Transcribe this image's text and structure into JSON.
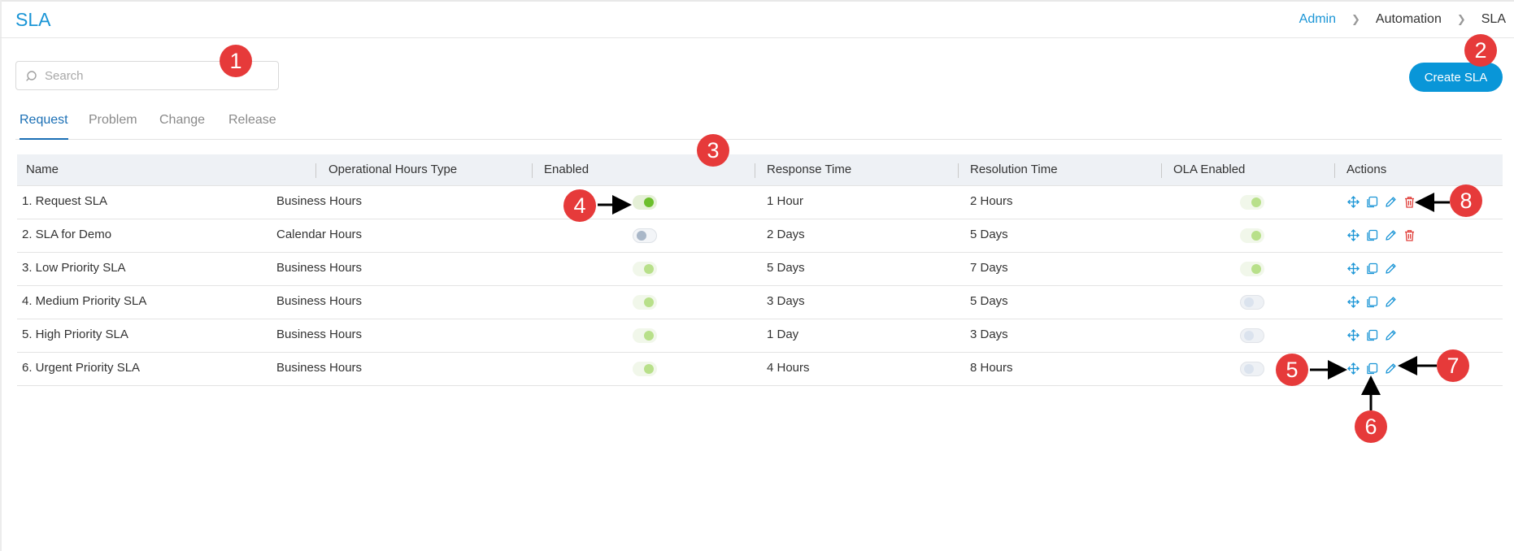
{
  "header": {
    "title": "SLA",
    "breadcrumb": [
      "Admin",
      "Automation",
      "SLA"
    ]
  },
  "search": {
    "placeholder": "Search",
    "value": ""
  },
  "create_button": {
    "label": "Create SLA"
  },
  "tabs": [
    {
      "label": "Request",
      "active": true
    },
    {
      "label": "Problem",
      "active": false
    },
    {
      "label": "Change",
      "active": false
    },
    {
      "label": "Release",
      "active": false
    }
  ],
  "table": {
    "columns": [
      "Name",
      "Operational Hours Type",
      "Enabled",
      "Response Time",
      "Resolution Time",
      "OLA Enabled",
      "Actions"
    ],
    "rows": [
      {
        "name": "1. Request SLA",
        "hours_type": "Business Hours",
        "enabled": true,
        "response": "1 Hour",
        "resolution": "2 Hours",
        "ola_enabled": true,
        "deletable": true
      },
      {
        "name": "2. SLA for Demo",
        "hours_type": "Calendar Hours",
        "enabled": false,
        "response": "2 Days",
        "resolution": "5 Days",
        "ola_enabled": true,
        "deletable": true
      },
      {
        "name": "3. Low Priority SLA",
        "hours_type": "Business Hours",
        "enabled": true,
        "response": "5 Days",
        "resolution": "7 Days",
        "ola_enabled": true,
        "deletable": false
      },
      {
        "name": "4. Medium Priority SLA",
        "hours_type": "Business Hours",
        "enabled": true,
        "response": "3 Days",
        "resolution": "5 Days",
        "ola_enabled": false,
        "deletable": false
      },
      {
        "name": "5. High Priority SLA",
        "hours_type": "Business Hours",
        "enabled": true,
        "response": "1 Day",
        "resolution": "3 Days",
        "ola_enabled": false,
        "deletable": false
      },
      {
        "name": "6. Urgent Priority SLA",
        "hours_type": "Business Hours",
        "enabled": true,
        "response": "4 Hours",
        "resolution": "8 Hours",
        "ola_enabled": false,
        "deletable": false
      }
    ]
  },
  "callouts": [
    "1",
    "2",
    "3",
    "4",
    "5",
    "6",
    "7",
    "8"
  ],
  "colors": {
    "accent": "#1a95d6",
    "button": "#0996d8",
    "callout": "#e63a3a",
    "delete": "#e0413c",
    "toggle_on": "#6cbf2c"
  },
  "icons": {
    "search": "search-icon",
    "move": "move-icon",
    "copy": "copy-icon",
    "edit": "edit-icon",
    "delete": "trash-icon",
    "breadcrumb_separator": "chevron-right-icon"
  }
}
